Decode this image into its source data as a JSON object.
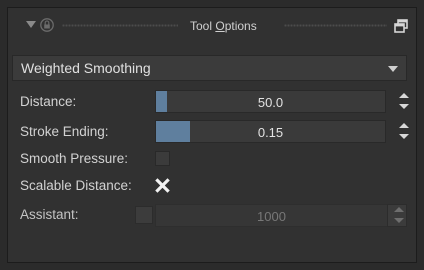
{
  "titlebar": {
    "title_prefix": "Tool ",
    "title_underlined": "O",
    "title_suffix": "ptions",
    "icons": [
      "collapse-arrow-icon",
      "lock-icon",
      "float-window-icon"
    ]
  },
  "smoothing_mode": {
    "selected": "Weighted Smoothing"
  },
  "distance": {
    "label": "Distance:",
    "value": "50.0",
    "fill_fraction": 0.05
  },
  "stroke_ending": {
    "label": "Stroke Ending:",
    "value": "0.15",
    "fill_fraction": 0.15
  },
  "smooth_pressure": {
    "label": "Smooth Pressure:",
    "checked": false
  },
  "scalable_distance": {
    "label": "Scalable Distance:",
    "checked": true
  },
  "assistant": {
    "label": "Assistant:",
    "checked": false,
    "magnetism_value": "1000",
    "enabled": false
  },
  "colors": {
    "accent_fill": "#5f7f9e",
    "panel_bg": "#313131"
  }
}
